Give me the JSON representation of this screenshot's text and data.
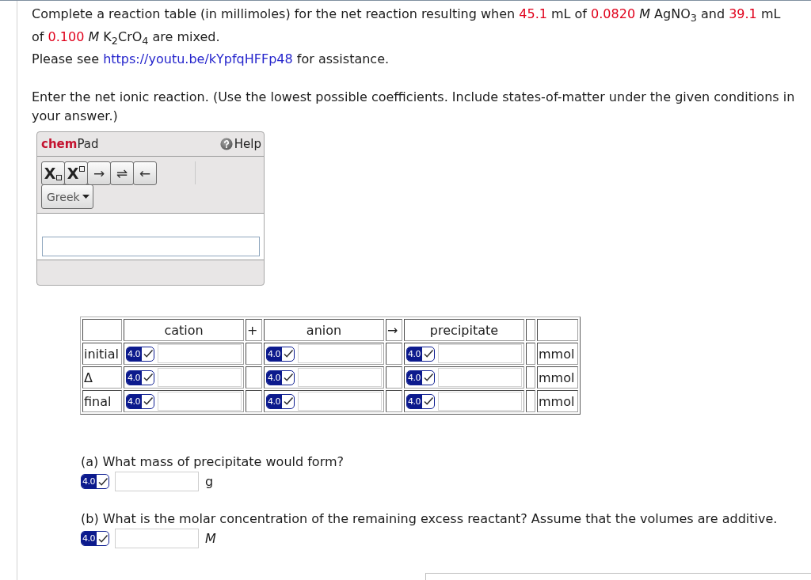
{
  "problem": {
    "intro": [
      {
        "text": "Complete a reaction table (in millimoles) for the net reaction resulting when ",
        "highlight": false
      },
      {
        "text": "45.1",
        "highlight": true
      },
      {
        "text": " mL of ",
        "highlight": false
      },
      {
        "text": "0.0820",
        "highlight": true
      },
      {
        "text": " *M* AgNO$_{3}$ and ",
        "highlight": false
      },
      {
        "text": "39.1",
        "highlight": true
      },
      {
        "text": " mL of ",
        "highlight": false
      },
      {
        "text": "0.100",
        "highlight": true
      },
      {
        "text": " *M* K$_{2}$CrO$_{4}$ are mixed.",
        "highlight": false
      }
    ],
    "help_line": {
      "before": "Please see ",
      "link": "https://youtu.be/kYpfqHFFp48",
      "after": " for assistance."
    }
  },
  "instruction": "Enter the net ionic reaction. (Use the lowest possible coefficients. Include states-of-matter under the given conditions in your answer.)",
  "chempad": {
    "title": "**chem**Pad",
    "help": "Help",
    "tools": [
      {
        "kind": "subscript",
        "label": "X"
      },
      {
        "kind": "superscript",
        "label": "X"
      },
      {
        "kind": "symbol",
        "label": "→"
      },
      {
        "kind": "symbol",
        "label": "⇌"
      },
      {
        "kind": "symbol",
        "label": "←"
      }
    ],
    "menus": [
      {
        "label": "Greek"
      }
    ]
  },
  "reaction_table": {
    "columns": [
      {
        "kind": "species",
        "label": "cation"
      },
      {
        "kind": "operator",
        "label": "+"
      },
      {
        "kind": "species",
        "label": "anion"
      },
      {
        "kind": "operator",
        "label": "→"
      },
      {
        "kind": "species",
        "label": "precipitate"
      }
    ],
    "rows": [
      {
        "label": "initial",
        "unit": "mmol",
        "entries": [
          {
            "sig_figs": "4.0"
          },
          {
            "sig_figs": "4.0"
          },
          {
            "sig_figs": "4.0"
          }
        ]
      },
      {
        "label": "Δ",
        "unit": "mmol",
        "entries": [
          {
            "sig_figs": "4.0"
          },
          {
            "sig_figs": "4.0"
          },
          {
            "sig_figs": "4.0"
          }
        ]
      },
      {
        "label": "final",
        "unit": "mmol",
        "entries": [
          {
            "sig_figs": "4.0"
          },
          {
            "sig_figs": "4.0"
          },
          {
            "sig_figs": "4.0"
          }
        ]
      }
    ]
  },
  "questions": [
    {
      "prompt": "(a) What mass of precipitate would form?",
      "sig_figs": "4.0",
      "unit": "g",
      "unit_italic": false
    },
    {
      "prompt": "(b) What is the molar concentration of the remaining excess reactant? Assume that the volumes are additive.",
      "sig_figs": "4.0",
      "unit": "M",
      "unit_italic": true
    }
  ]
}
